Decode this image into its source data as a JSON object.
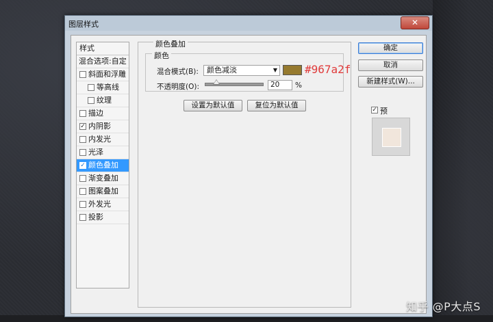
{
  "window": {
    "title": "图层样式",
    "close_label": "✕"
  },
  "sidebar": {
    "header": "样式",
    "blend_options": "混合选项:自定",
    "items": [
      {
        "label": "斜面和浮雕",
        "checked": false,
        "indent": false
      },
      {
        "label": "等高线",
        "checked": false,
        "indent": true
      },
      {
        "label": "纹理",
        "checked": false,
        "indent": true
      },
      {
        "label": "描边",
        "checked": false,
        "indent": false
      },
      {
        "label": "内阴影",
        "checked": true,
        "indent": false
      },
      {
        "label": "内发光",
        "checked": false,
        "indent": false
      },
      {
        "label": "光泽",
        "checked": false,
        "indent": false
      },
      {
        "label": "颜色叠加",
        "checked": true,
        "indent": false,
        "selected": true
      },
      {
        "label": "渐变叠加",
        "checked": false,
        "indent": false
      },
      {
        "label": "图案叠加",
        "checked": false,
        "indent": false
      },
      {
        "label": "外发光",
        "checked": false,
        "indent": false
      },
      {
        "label": "投影",
        "checked": false,
        "indent": false
      }
    ]
  },
  "panel": {
    "group_title": "颜色叠加",
    "sub_title": "颜色",
    "blend_mode_label": "混合模式(B):",
    "blend_mode_value": "颜色减淡",
    "swatch_color": "#967a2f",
    "hex_annotation": "#967a2f",
    "opacity_label": "不透明度(O):",
    "opacity_value": "20",
    "opacity_unit": "%",
    "opacity_percent": 20,
    "make_default": "设置为默认值",
    "reset_default": "复位为默认值"
  },
  "actions": {
    "ok": "确定",
    "cancel": "取消",
    "new_style": "新建样式(W)...",
    "preview_label": "预览(V)",
    "preview_checked": true
  },
  "watermark": "知乎 @P大点S"
}
